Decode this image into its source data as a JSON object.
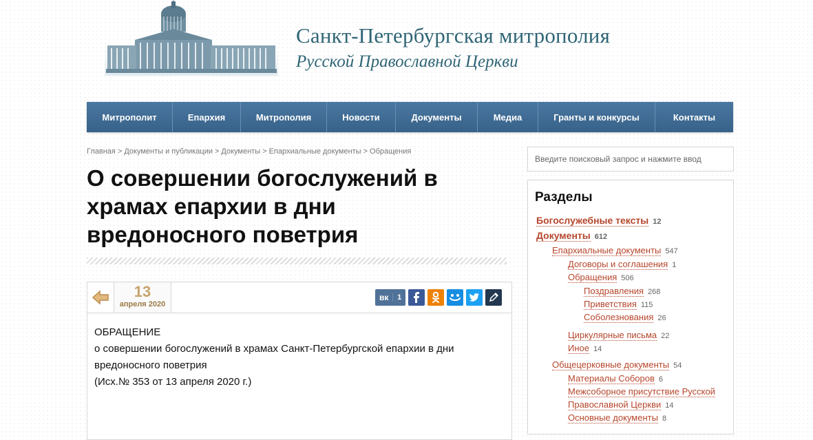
{
  "site": {
    "title": "Санкт-Петербургская митрополия",
    "subtitle": "Русской Православной Церкви"
  },
  "nav": [
    "Митрополит",
    "Епархия",
    "Митрополия",
    "Новости",
    "Документы",
    "Медиа",
    "Гранты и конкурсы",
    "Контакты"
  ],
  "breadcrumb": [
    "Главная",
    "Документы и публикации",
    "Документы",
    "Епархиальные документы",
    "Обращения"
  ],
  "breadcrumb_sep": ">",
  "article": {
    "title": "О совершении богослужений в храмах епархии в дни вредоносного поветрия",
    "date_day": "13",
    "date_month": "апреля 2020",
    "vk_label": "вк",
    "vk_count": "1",
    "body": [
      "ОБРАЩЕНИЕ",
      "о совершении богослужений в храмах Санкт-Петербургской епархии в дни",
      "вредоносного поветрия",
      "(Исх.№ 353 от 13 апреля 2020 г.)"
    ]
  },
  "share_icons": [
    "vk-icon",
    "facebook-icon",
    "odnoklassniki-icon",
    "moimir-icon",
    "twitter-icon",
    "livejournal-icon"
  ],
  "search": {
    "placeholder": "Введите поисковый запрос и нажмите ввод"
  },
  "sections": {
    "title": "Разделы",
    "items": [
      {
        "label": "Богослужебные тексты",
        "count": "12"
      },
      {
        "label": "Документы",
        "count": "612"
      },
      {
        "label": "Епархиальные документы",
        "count": "547"
      },
      {
        "label": "Договоры и соглашения",
        "count": "1"
      },
      {
        "label": "Обращения",
        "count": "506"
      },
      {
        "label": "Поздравления",
        "count": "268"
      },
      {
        "label": "Приветствия",
        "count": "115"
      },
      {
        "label": "Соболезнования",
        "count": "26"
      },
      {
        "label": "Циркулярные письма",
        "count": "22"
      },
      {
        "label": "Иное",
        "count": "14"
      },
      {
        "label": "Общецерковные документы",
        "count": "54"
      },
      {
        "label": "Материалы Соборов",
        "count": "6"
      },
      {
        "label": "Межсоборное присутствие Русской",
        "count": ""
      },
      {
        "label": "Православной Церкви",
        "count": "14"
      },
      {
        "label": "Основные документы",
        "count": "8"
      }
    ]
  },
  "colors": {
    "nav_bg": "#3d6a94",
    "link": "#b5462c",
    "date": "#c8a46e",
    "title_teal": "#2f6576"
  }
}
